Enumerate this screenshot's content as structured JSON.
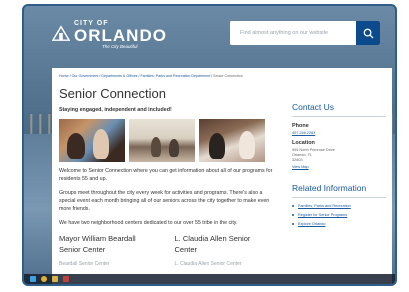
{
  "header": {
    "logo_city": "CITY OF",
    "logo_name": "ORLANDO",
    "logo_tagline": "The City Beautiful",
    "search_placeholder": "Find almost anything on our website"
  },
  "breadcrumb": {
    "items": [
      "Home",
      "Our Government",
      "Departments & Offices",
      "Families, Parks and Recreation Department",
      "Senior Connection"
    ],
    "separator": " / "
  },
  "main": {
    "title": "Senior Connection",
    "subtitle": "Staying engaged, independent and included!",
    "paragraphs": [
      "Welcome to Senior Connection where you can get information about all of our programs for residents 55 and up.",
      "Groups meet throughout the city every week for activities and programs. There's also a special event each month bringing all of our seniors across the city together to make even more friends.",
      "We have two neighborhood centers dedicated to our over 55 tribe in the city."
    ],
    "centers": [
      {
        "name": "Mayor William Beardall Senior Center",
        "sub": "Beardall Senior Center"
      },
      {
        "name": "L. Claudia Allen Senior Center",
        "sub": "L. Claudia Allen Senior Center"
      }
    ]
  },
  "sidebar": {
    "contact_heading": "Contact Us",
    "phone_label": "Phone",
    "phone_value": "407.246.2283",
    "location_label": "Location",
    "address_lines": [
      "595 North Primrose Drive",
      "Orlando, FL",
      "32803"
    ],
    "map_link": "View Map",
    "related_heading": "Related Information",
    "related_items": [
      "Families, Parks and Recreation",
      "Register for Senior Programs",
      "Explore Orlando"
    ]
  },
  "colors": {
    "accent": "#1a5aa0",
    "search_button": "#0b4a8c",
    "bezel": "#2f5e8a"
  },
  "icons": {
    "logo": "city-skyline-logo-icon",
    "search": "search-icon"
  }
}
